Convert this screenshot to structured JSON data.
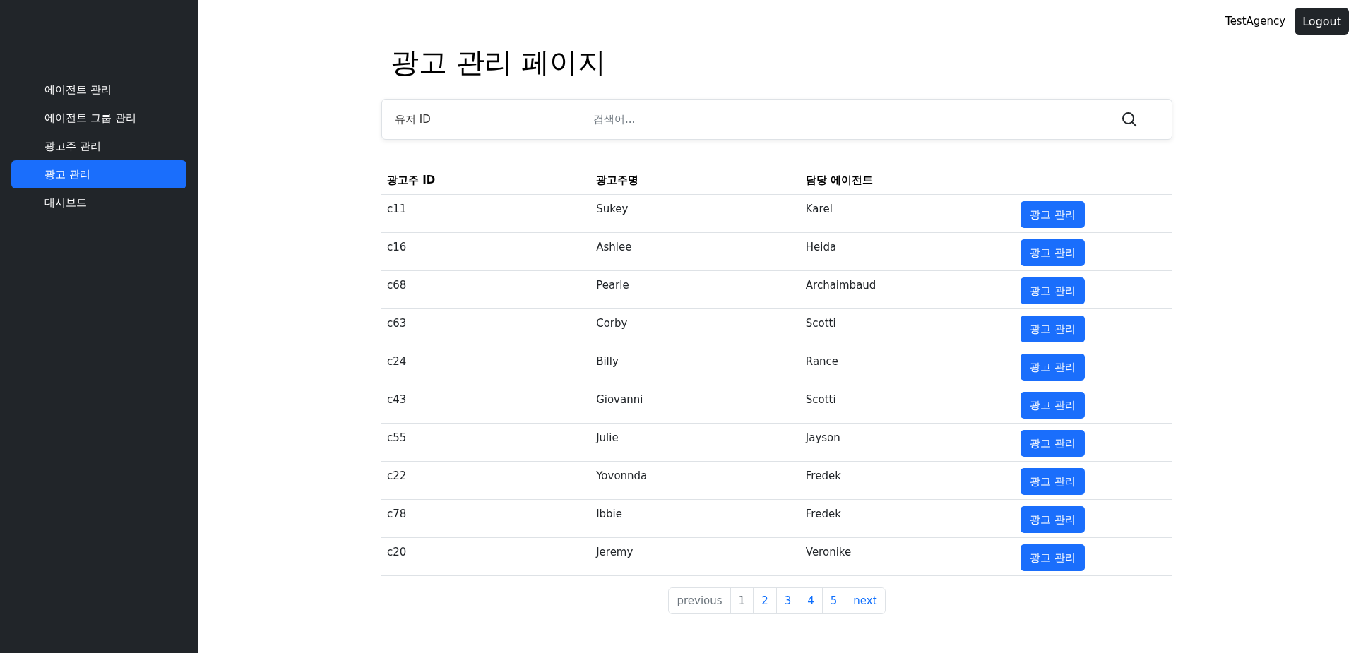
{
  "sidebar": {
    "items": [
      {
        "label": "에이전트 관리",
        "selected": false
      },
      {
        "label": "에이전트 그룹 관리",
        "selected": false
      },
      {
        "label": "광고주 관리",
        "selected": false
      },
      {
        "label": "광고 관리",
        "selected": true
      },
      {
        "label": "대시보드",
        "selected": false
      }
    ]
  },
  "header": {
    "user": "TestAgency",
    "logout": "Logout"
  },
  "title": "광고 관리 페이지",
  "search": {
    "label": "유저 ID",
    "placeholder": "검색어..."
  },
  "table": {
    "columns": [
      "광고주 ID",
      "광고주명",
      "담당 에이전트"
    ],
    "rows": [
      {
        "id": "c11",
        "name": "Sukey",
        "agent": "Karel",
        "action": "광고 관리"
      },
      {
        "id": "c16",
        "name": "Ashlee",
        "agent": "Heida",
        "action": "광고 관리"
      },
      {
        "id": "c68",
        "name": "Pearle",
        "agent": "Archaimbaud",
        "action": "광고 관리"
      },
      {
        "id": "c63",
        "name": "Corby",
        "agent": "Scotti",
        "action": "광고 관리"
      },
      {
        "id": "c24",
        "name": "Billy",
        "agent": "Rance",
        "action": "광고 관리"
      },
      {
        "id": "c43",
        "name": "Giovanni",
        "agent": "Scotti",
        "action": "광고 관리"
      },
      {
        "id": "c55",
        "name": "Julie",
        "agent": "Jayson",
        "action": "광고 관리"
      },
      {
        "id": "c22",
        "name": "Yovonnda",
        "agent": "Fredek",
        "action": "광고 관리"
      },
      {
        "id": "c78",
        "name": "Ibbie",
        "agent": "Fredek",
        "action": "광고 관리"
      },
      {
        "id": "c20",
        "name": "Jeremy",
        "agent": "Veronike",
        "action": "광고 관리"
      }
    ]
  },
  "pagination": {
    "previous": {
      "label": "previous",
      "disabled": true
    },
    "pages": [
      {
        "label": "1",
        "selected": true
      },
      {
        "label": "2",
        "selected": false
      },
      {
        "label": "3",
        "selected": false
      },
      {
        "label": "4",
        "selected": false
      },
      {
        "label": "5",
        "selected": false
      }
    ],
    "next": {
      "label": "next",
      "disabled": false
    }
  }
}
